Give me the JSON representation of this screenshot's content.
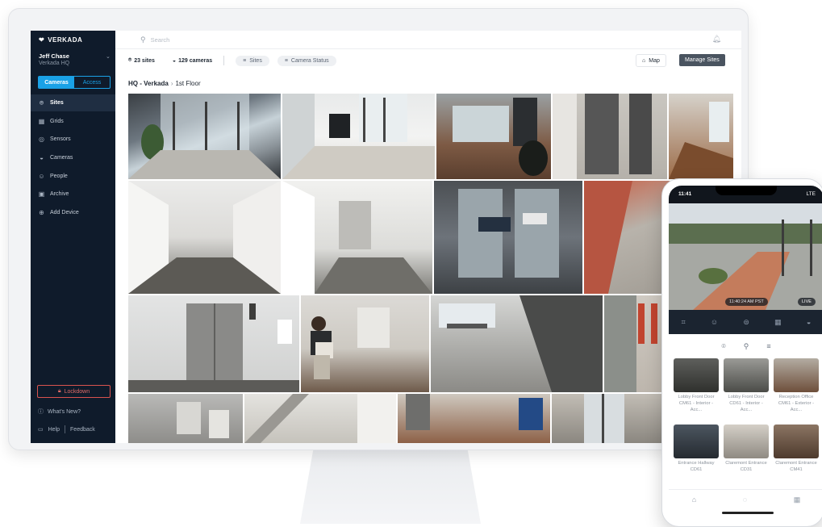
{
  "brand": "VERKADA",
  "user": {
    "name": "Jeff Chase",
    "org": "Verkada HQ"
  },
  "segment": {
    "left": "Cameras",
    "right": "Access"
  },
  "nav": [
    {
      "label": "Sites",
      "icon": "pin-icon",
      "glyph": "⌾"
    },
    {
      "label": "Grids",
      "icon": "grid-icon",
      "glyph": "▦"
    },
    {
      "label": "Sensors",
      "icon": "sensor-icon",
      "glyph": "◎"
    },
    {
      "label": "Cameras",
      "icon": "camera-icon",
      "glyph": "◒"
    },
    {
      "label": "People",
      "icon": "people-icon",
      "glyph": "☺"
    },
    {
      "label": "Archive",
      "icon": "archive-icon",
      "glyph": "▣"
    },
    {
      "label": "Add Device",
      "icon": "add-device-icon",
      "glyph": "⊕"
    }
  ],
  "lockdown": "Lockdown",
  "whats_new": "What's New?",
  "help": "Help",
  "feedback": "Feedback",
  "search_placeholder": "Search",
  "toolbar": {
    "sites": "23 sites",
    "cameras": "129 cameras",
    "filter_sites": "Sites",
    "filter_status": "Camera Status",
    "map": "Map",
    "manage": "Manage Sites"
  },
  "breadcrumb": {
    "site": "HQ - Verkada",
    "floor": "1st Floor"
  },
  "colors": {
    "sidebar": "#0f1b2b",
    "accent": "#1aa1e6",
    "danger": "#d9534f"
  },
  "phone": {
    "time": "11:41",
    "signal": "LTE",
    "timestamp": "11:40:24 AM PST",
    "live": "LIVE",
    "tiles": [
      {
        "label": "Lobby Front Door CM61 - Interior - Acc..."
      },
      {
        "label": "Lobby Front Door CD61 - Interior - Acc..."
      },
      {
        "label": "Reception Office CM61 - Exterior - Acc..."
      },
      {
        "label": "Entrance Hallway CD61"
      },
      {
        "label": "Claremont Entrance CD31"
      },
      {
        "label": "Claremont Entrance CM41"
      }
    ]
  }
}
